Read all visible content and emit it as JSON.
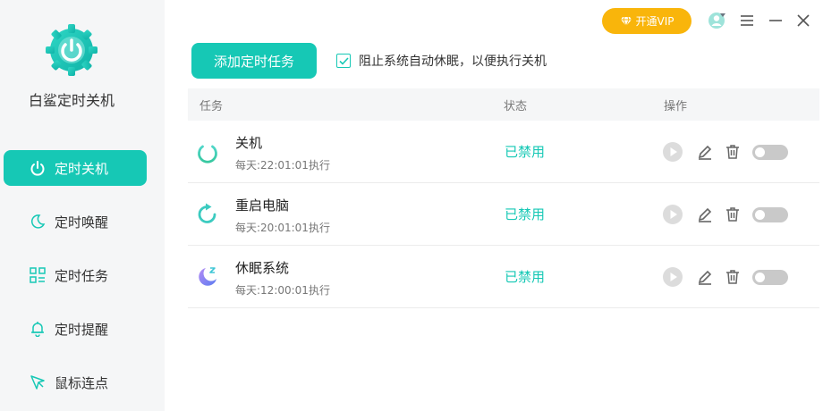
{
  "app": {
    "name": "白鲨定时关机",
    "accent_color": "#16c8b5",
    "vip_color": "#f9b50b"
  },
  "sidebar": {
    "items": [
      {
        "label": "定时关机",
        "icon": "power-icon",
        "active": true
      },
      {
        "label": "定时唤醒",
        "icon": "moon-icon",
        "active": false
      },
      {
        "label": "定时任务",
        "icon": "grid-list-icon",
        "active": false
      },
      {
        "label": "定时提醒",
        "icon": "bell-icon",
        "active": false
      },
      {
        "label": "鼠标连点",
        "icon": "cursor-click-icon",
        "active": false
      }
    ]
  },
  "topbar": {
    "vip_label": "开通VIP",
    "icons": [
      "user-avatar-icon",
      "menu-icon",
      "minimize-icon",
      "close-icon"
    ]
  },
  "toolbar": {
    "add_task_label": "添加定时任务",
    "prevent_sleep_label": "阻止系统自动休眠，以便执行关机",
    "prevent_sleep_checked": true
  },
  "table": {
    "headers": {
      "task": "任务",
      "status": "状态",
      "actions": "操作"
    },
    "rows": [
      {
        "name": "关机",
        "schedule": "每天:22:01:01执行",
        "status": "已禁用",
        "icon": "power-icon",
        "enabled": false
      },
      {
        "name": "重启电脑",
        "schedule": "每天:20:01:01执行",
        "status": "已禁用",
        "icon": "restart-icon",
        "enabled": false
      },
      {
        "name": "休眠系统",
        "schedule": "每天:12:00:01执行",
        "status": "已禁用",
        "icon": "sleep-moon-icon",
        "enabled": false
      }
    ]
  }
}
